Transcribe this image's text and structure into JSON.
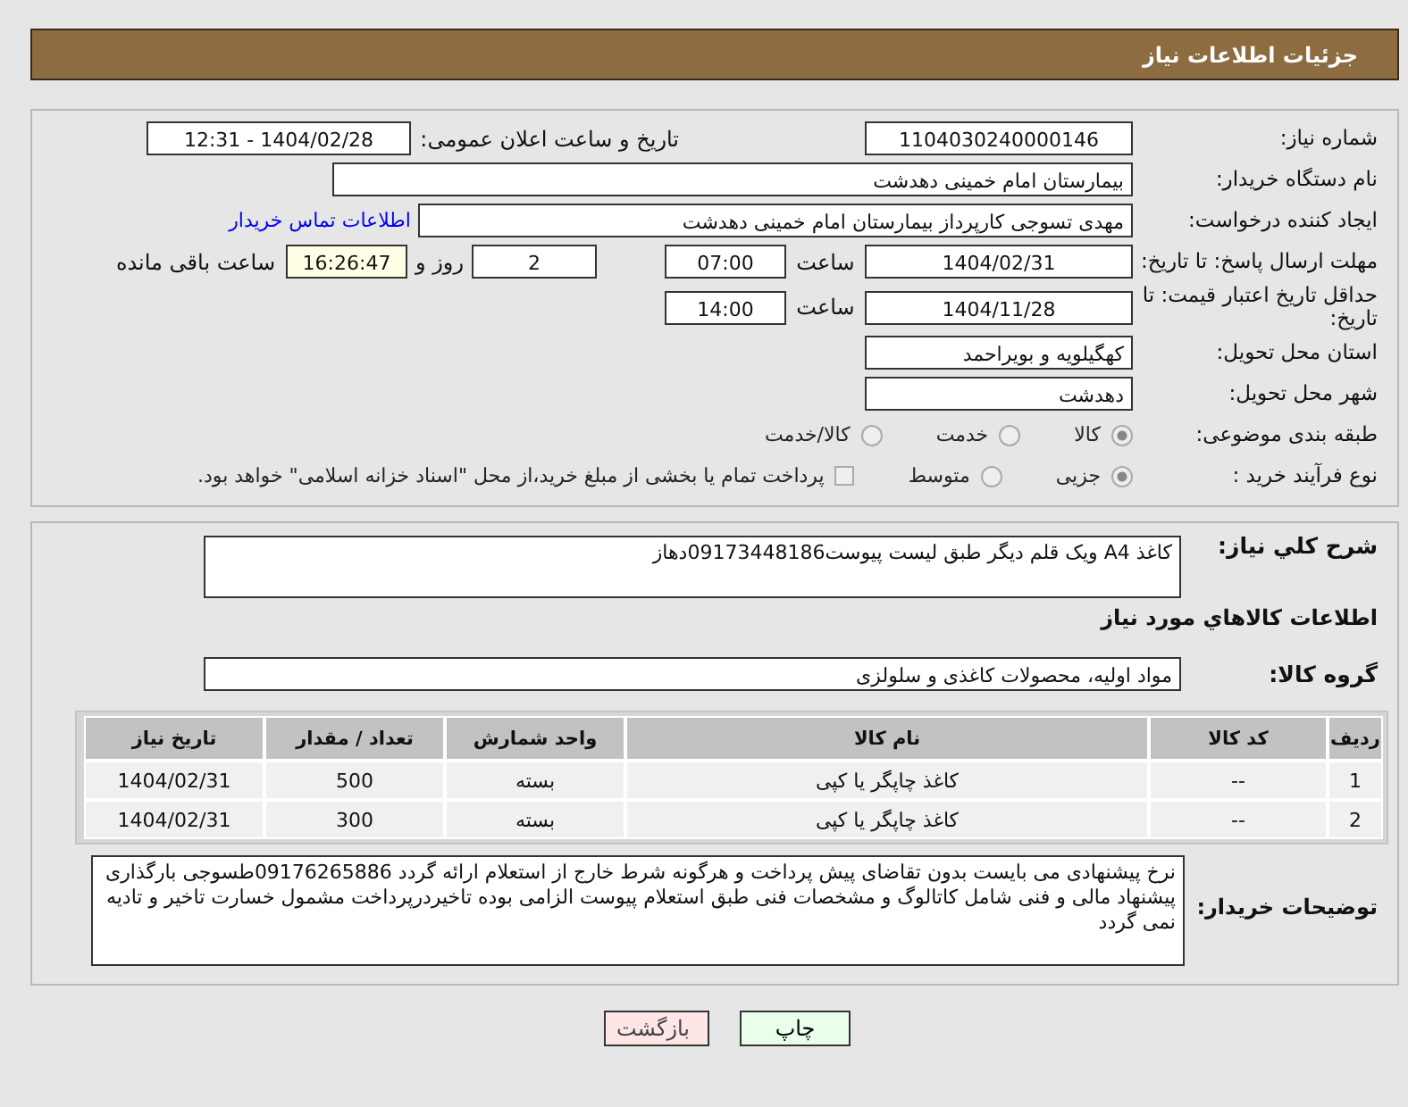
{
  "header": {
    "title": "جزئیات اطلاعات نیاز"
  },
  "need_number": {
    "label": "شماره نیاز:",
    "value": "1104030240000146"
  },
  "announce": {
    "label": "تاریخ و ساعت اعلان عمومی:",
    "value": "1404/02/28 - 12:31"
  },
  "buyer_org": {
    "label": "نام دستگاه خریدار:",
    "value": "بیمارستان امام خمینی دهدشت"
  },
  "requester": {
    "label": "ایجاد کننده درخواست:",
    "value": "مهدی تسوجی کارپرداز بیمارستان امام خمینی دهدشت",
    "link": "اطلاعات تماس خریدار"
  },
  "reply_deadline": {
    "label": "مهلت ارسال پاسخ: تا تاریخ:",
    "date": "1404/02/31",
    "time_label": "ساعت",
    "time": "07:00",
    "days": "2",
    "days_label": "روز و",
    "remaining": "16:26:47",
    "remaining_label": "ساعت باقی مانده"
  },
  "price_validity": {
    "label": "حداقل تاریخ اعتبار قیمت: تا تاریخ:",
    "date": "1404/11/28",
    "time_label": "ساعت",
    "time": "14:00"
  },
  "province": {
    "label": "استان محل تحویل:",
    "value": "کهگیلویه و بویراحمد"
  },
  "city": {
    "label": "شهر محل تحویل:",
    "value": "دهدشت"
  },
  "category": {
    "label": "طبقه بندی موضوعی:",
    "options": [
      {
        "label": "کالا",
        "selected": true
      },
      {
        "label": "خدمت",
        "selected": false
      },
      {
        "label": "کالا/خدمت",
        "selected": false
      }
    ]
  },
  "process": {
    "label": "نوع فرآیند خرید :",
    "options": [
      {
        "label": "جزیی",
        "selected": true
      },
      {
        "label": "متوسط",
        "selected": false
      }
    ],
    "treasury": {
      "label": "پرداخت تمام یا بخشی از مبلغ خرید،از محل \"اسناد خزانه اسلامی\" خواهد بود.",
      "checked": false
    }
  },
  "description": {
    "label": "شرح كلي نياز:",
    "value": "کاغذ A4 ویک قلم دیگر طبق لیست پیوست09173448186دهاز"
  },
  "goods_heading": "اطلاعات کالاهاي مورد نياز",
  "goods_group": {
    "label": "گروه کالا:",
    "value": "مواد اولیه، محصولات کاغذی و سلولزی"
  },
  "table": {
    "columns": [
      "ردیف",
      "کد کالا",
      "نام کالا",
      "واحد شمارش",
      "تعداد / مقدار",
      "تاریخ نیاز"
    ],
    "rows": [
      [
        "1",
        "--",
        "کاغذ چاپگر یا کپی",
        "بسته",
        "500",
        "1404/02/31"
      ],
      [
        "2",
        "--",
        "کاغذ چاپگر یا کپی",
        "بسته",
        "300",
        "1404/02/31"
      ]
    ]
  },
  "buyer_notes": {
    "label": "توضیحات خریدار:",
    "value": "نرخ پیشنهادی می بایست بدون تقاضای پیش پرداخت و هرگونه شرط خارج از استعلام ارائه گردد 09176265886طسوجی بارگذاری پیشنهاد مالی و فنی شامل کاتالوگ و مشخصات فنی طبق استعلام پیوست الزامی بوده تاخیردرپرداخت مشمول خسارت تاخیر و تادیه نمی گردد"
  },
  "buttons": [
    {
      "label": "چاپ",
      "kind": "print"
    },
    {
      "label": "بازگشت",
      "kind": "back"
    }
  ]
}
